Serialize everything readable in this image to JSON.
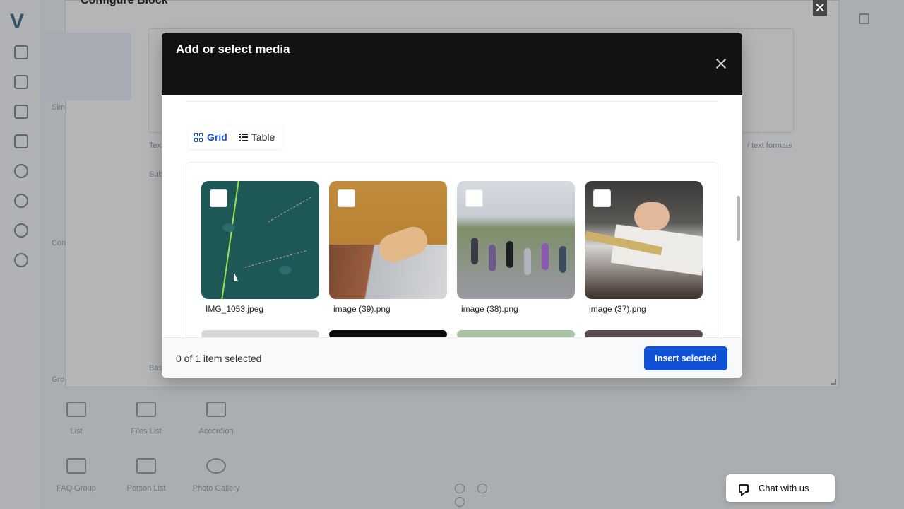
{
  "background": {
    "logo": "V",
    "panel_title": "Configure Block",
    "labels": [
      "List",
      "Files List",
      "Accordion",
      "FAQ Group",
      "Person List",
      "Photo Gallery"
    ],
    "side_texts": [
      "Sim",
      "Tex",
      "Sub",
      "Con",
      "Gro",
      "Bas"
    ],
    "right_hint": "/ text formats"
  },
  "modal": {
    "title": "Add or select media",
    "view_toggle": {
      "grid_label": "Grid",
      "table_label": "Table"
    },
    "media": [
      {
        "name": "IMG_1053.jpeg",
        "thumb": "map"
      },
      {
        "name": "image (39).png",
        "thumb": "laptop"
      },
      {
        "name": "image (38).png",
        "thumb": "crowd"
      },
      {
        "name": "image (37).png",
        "thumb": "desk"
      }
    ],
    "footer": {
      "selection_text": "0 of 1 item selected",
      "insert_label": "Insert selected"
    }
  },
  "chat": {
    "label": "Chat with us"
  },
  "colors": {
    "accent": "#1151d6",
    "header_bg": "#101213"
  }
}
